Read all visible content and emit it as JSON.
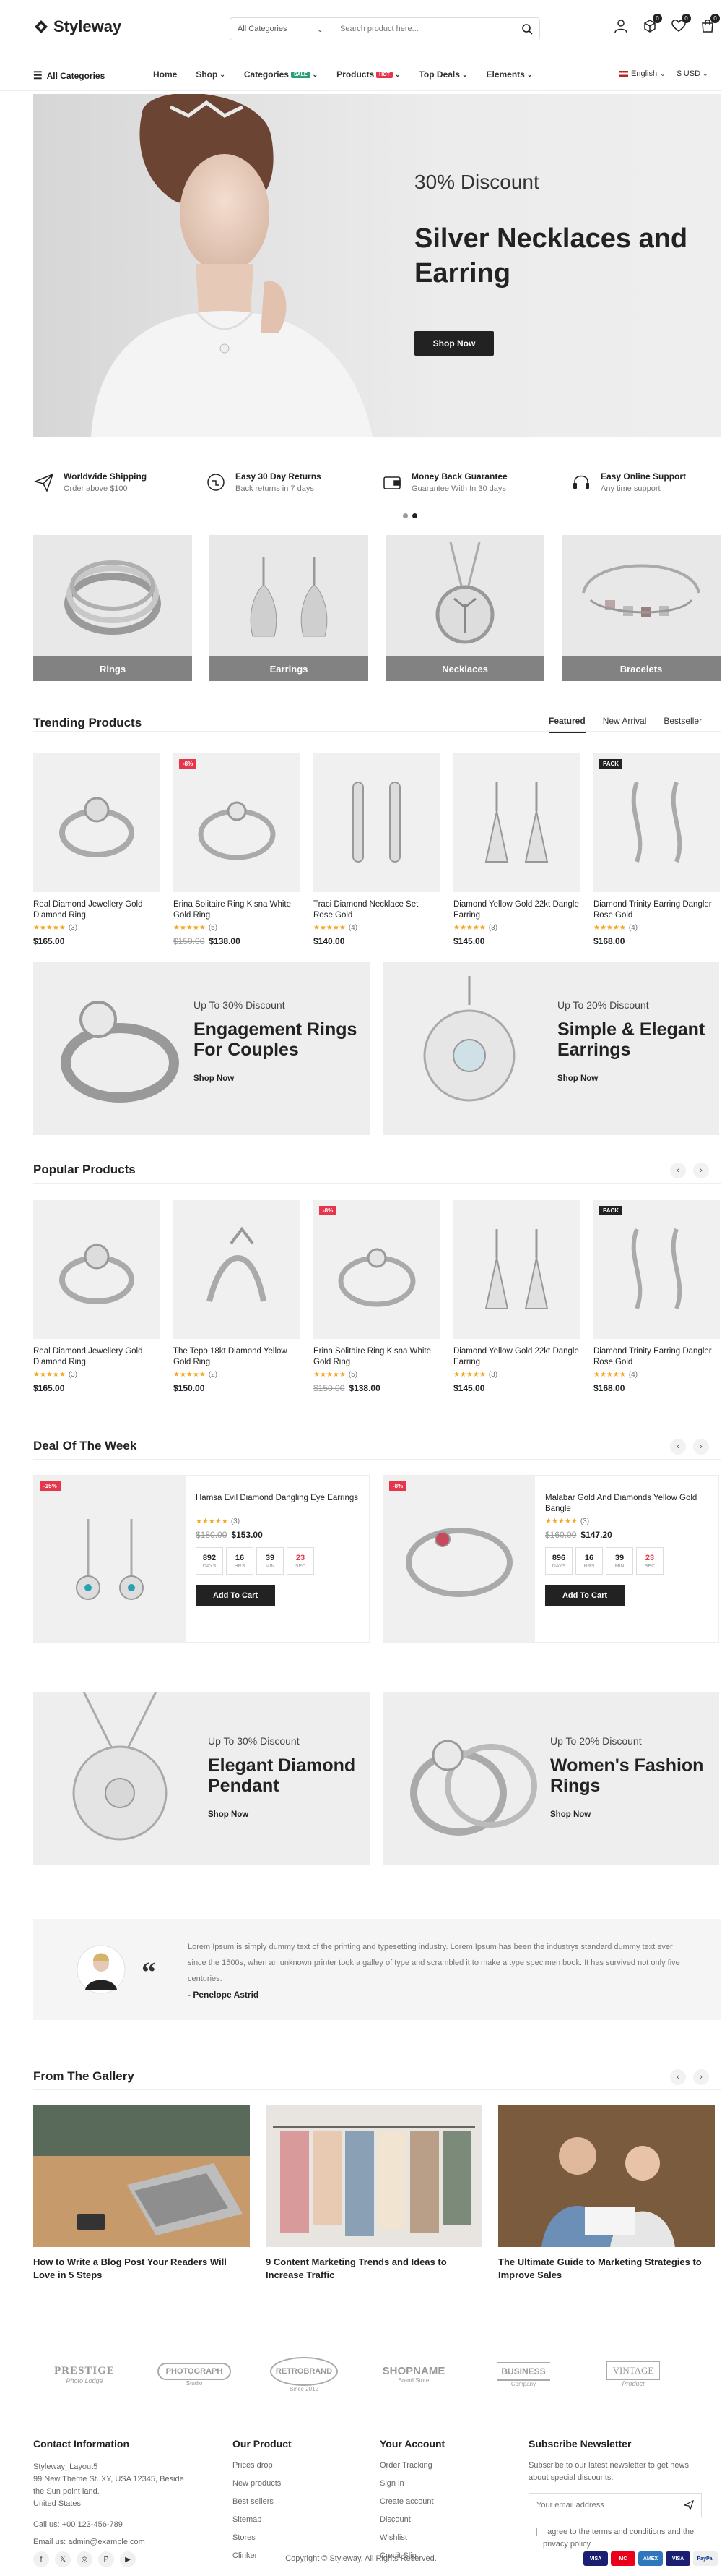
{
  "header": {
    "logo": "Styleway",
    "search_category": "All Categories",
    "search_placeholder": "Search product here...",
    "compare_count": "0",
    "wishlist_count": "0",
    "cart_count": "0"
  },
  "nav": {
    "all_categories": "All Categories",
    "items": [
      {
        "label": "Home"
      },
      {
        "label": "Shop"
      },
      {
        "label": "Categories",
        "tag": "SALE"
      },
      {
        "label": "Products",
        "tag": "HOT"
      },
      {
        "label": "Top Deals"
      },
      {
        "label": "Elements"
      }
    ],
    "language": "English",
    "currency": "$ USD"
  },
  "hero": {
    "discount": "30% Discount",
    "title": "Silver Necklaces and Earring",
    "button": "Shop Now"
  },
  "services": [
    {
      "title": "Worldwide Shipping",
      "sub": "Order above $100",
      "icon": "paper-plane-icon"
    },
    {
      "title": "Easy 30 Day Returns",
      "sub": "Back returns in 7 days",
      "icon": "returns-icon"
    },
    {
      "title": "Money Back Guarantee",
      "sub": "Guarantee With In 30 days",
      "icon": "wallet-icon"
    },
    {
      "title": "Easy Online Support",
      "sub": "Any time support",
      "icon": "headset-icon"
    }
  ],
  "categories": [
    "Rings",
    "Earrings",
    "Necklaces",
    "Bracelets"
  ],
  "trending": {
    "title": "Trending Products",
    "tabs": [
      "Featured",
      "New Arrival",
      "Bestseller"
    ],
    "products": [
      {
        "name": "Real Diamond Jewellery Gold Diamond Ring",
        "rating": "(3)",
        "price": "$165.00",
        "old": "",
        "badge": ""
      },
      {
        "name": "Erina Solitaire Ring Kisna White Gold Ring",
        "rating": "(5)",
        "price": "$138.00",
        "old": "$150.00",
        "badge": "-8%"
      },
      {
        "name": "Traci Diamond Necklace Set Rose Gold",
        "rating": "(4)",
        "price": "$140.00",
        "old": "",
        "badge": ""
      },
      {
        "name": "Diamond Yellow Gold 22kt Dangle Earring",
        "rating": "(3)",
        "price": "$145.00",
        "old": "",
        "badge": ""
      },
      {
        "name": "Diamond Trinity Earring Dangler Rose Gold",
        "rating": "(4)",
        "price": "$168.00",
        "old": "",
        "badge": "PACK"
      }
    ]
  },
  "promo1": [
    {
      "sub": "Up To 30% Discount",
      "title": "Engagement Rings For Couples",
      "link": "Shop Now"
    },
    {
      "sub": "Up To 20% Discount",
      "title": "Simple & Elegant Earrings",
      "link": "Shop Now"
    }
  ],
  "popular": {
    "title": "Popular Products",
    "products": [
      {
        "name": "Real Diamond Jewellery Gold Diamond Ring",
        "rating": "(3)",
        "price": "$165.00",
        "old": "",
        "badge": ""
      },
      {
        "name": "The Tepo 18kt Diamond Yellow Gold Ring",
        "rating": "(2)",
        "price": "$150.00",
        "old": "",
        "badge": ""
      },
      {
        "name": "Erina Solitaire Ring Kisna White Gold Ring",
        "rating": "(5)",
        "price": "$138.00",
        "old": "$150.00",
        "badge": "-8%"
      },
      {
        "name": "Diamond Yellow Gold 22kt Dangle Earring",
        "rating": "(3)",
        "price": "$145.00",
        "old": "",
        "badge": ""
      },
      {
        "name": "Diamond Trinity Earring Dangler Rose Gold",
        "rating": "(4)",
        "price": "$168.00",
        "old": "",
        "badge": "PACK"
      }
    ]
  },
  "deals": {
    "title": "Deal Of The Week",
    "items": [
      {
        "badge": "-15%",
        "name": "Hamsa Evil Diamond Dangling Eye Earrings",
        "rating": "(3)",
        "old": "$180.00",
        "price": "$153.00",
        "days": "892",
        "hrs": "16",
        "min": "39",
        "sec": "23",
        "button": "Add To Cart"
      },
      {
        "badge": "-8%",
        "name": "Malabar Gold And Diamonds Yellow Gold Bangle",
        "rating": "(3)",
        "old": "$160.00",
        "price": "$147.20",
        "days": "896",
        "hrs": "16",
        "min": "39",
        "sec": "23",
        "button": "Add To Cart"
      }
    ],
    "labels": {
      "days": "DAYS",
      "hrs": "HRS",
      "min": "MIN",
      "sec": "SEC"
    }
  },
  "promo2": [
    {
      "sub": "Up To 30% Discount",
      "title": "Elegant Diamond Pendant",
      "link": "Shop Now"
    },
    {
      "sub": "Up To 20% Discount",
      "title": "Women's Fashion Rings",
      "link": "Shop Now"
    }
  ],
  "testimonial": {
    "text": "Lorem Ipsum is simply dummy text of the printing and typesetting industry. Lorem Ipsum has been the industrys standard dummy text ever since the 1500s, when an unknown printer took a galley of type and scrambled it to make a type specimen book. It has survived not only five centuries.",
    "author": "- Penelope Astrid"
  },
  "gallery": {
    "title": "From The Gallery",
    "posts": [
      "How to Write a Blog Post Your Readers Will Love in 5 Steps",
      "9 Content Marketing Trends and Ideas to Increase Traffic",
      "The Ultimate Guide to Marketing Strategies to Improve Sales"
    ]
  },
  "brands": [
    {
      "main": "PRESTIGE",
      "sub": "Photo Lodge"
    },
    {
      "main": "PHOTOGRAPH",
      "sub": "Studio"
    },
    {
      "main": "RETROBRAND",
      "sub": "Since 2012"
    },
    {
      "main": "SHOPNAME",
      "sub": "Brand Store"
    },
    {
      "main": "BUSINESS",
      "sub": "Company"
    },
    {
      "main": "VINTAGE",
      "sub": "Product"
    }
  ],
  "footer": {
    "contact": {
      "title": "Contact Information",
      "lines": [
        "Styleway_Layout5",
        "99 New Theme St. XY, USA 12345, Beside",
        "the Sun point land.",
        "United States"
      ],
      "call": "Call us: +00 123-456-789",
      "email": "Email us: admin@example.com"
    },
    "product": {
      "title": "Our Product",
      "links": [
        "Prices drop",
        "New products",
        "Best sellers",
        "Sitemap",
        "Stores",
        "Clinker"
      ]
    },
    "account": {
      "title": "Your Account",
      "links": [
        "Order Tracking",
        "Sign in",
        "Create account",
        "Discount",
        "Wishlist",
        "Credit Slip"
      ]
    },
    "newsletter": {
      "title": "Subscribe Newsletter",
      "text": "Subscribe to our latest newsletter to get news about special discounts.",
      "placeholder": "Your email address",
      "agree": "I agree to the terms and conditions and the privacy policy"
    },
    "copyright": "Copyright © Styleway. All Rights Reserved.",
    "payments": [
      "VISA",
      "MC",
      "AMEX",
      "VISA",
      "PayPal"
    ]
  },
  "colors": {
    "sale": "#2aa07a",
    "hot": "#e5364b",
    "accent": "#222222",
    "star": "#f5a623"
  }
}
